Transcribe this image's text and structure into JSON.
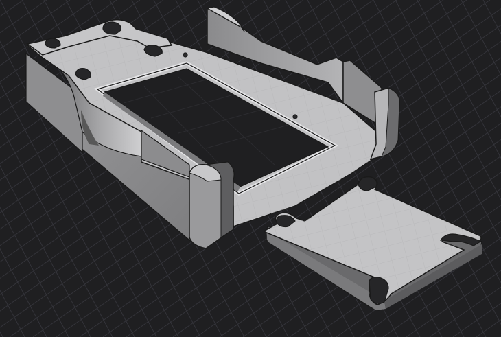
{
  "viewport": {
    "background": "#1f1f21",
    "grid_color": "#34343a",
    "grid_major_color": "#3c3c42"
  },
  "model": {
    "top_face_color": "#c2c2c4",
    "side_light_color": "#a9a9ab",
    "side_dark_color": "#6e6e70",
    "edge_color": "#1a1a1a",
    "surface_grid_color": "#b2b2b4",
    "hole_color": "#1f1f21"
  }
}
